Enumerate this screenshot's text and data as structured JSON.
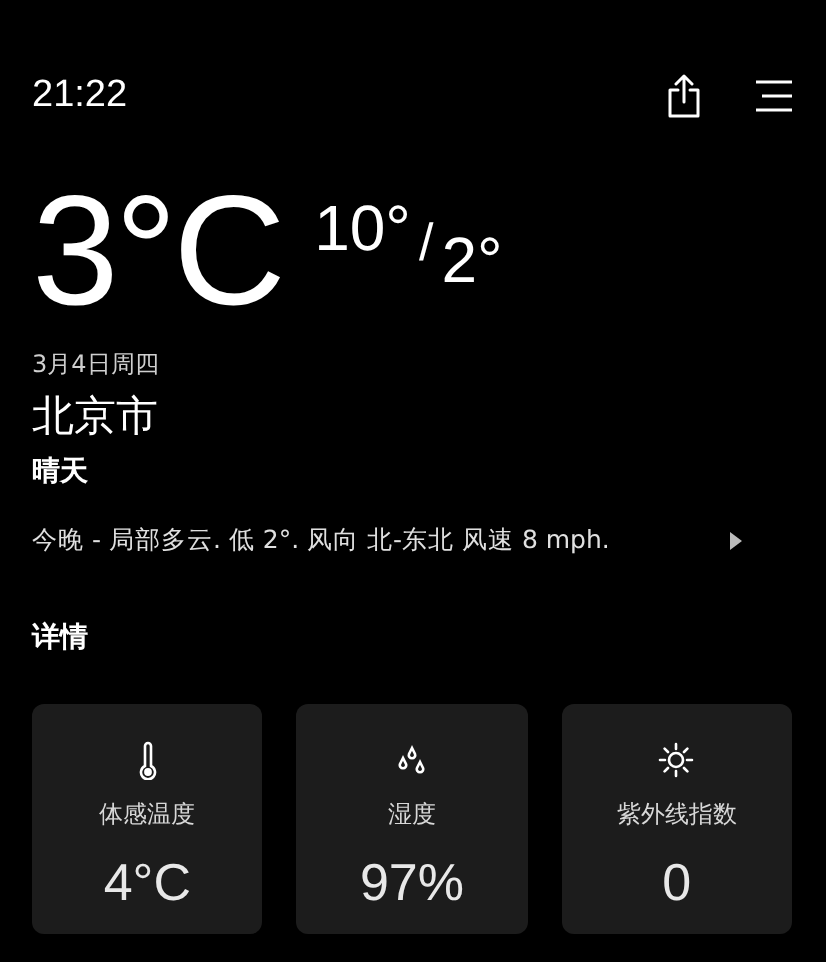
{
  "status_bar": {
    "time": "21:22"
  },
  "current": {
    "temperature": "3°C",
    "high": "10°",
    "separator": "/",
    "low": "2°"
  },
  "date": "3月4日周四",
  "city": "北京市",
  "condition": "晴天",
  "forecast": {
    "text": "今晚 - 局部多云. 低 2°. 风向 北-东北 风速 8 mph."
  },
  "details": {
    "title": "详情",
    "cards": [
      {
        "kind": "thermometer",
        "label": "体感温度",
        "value": "4°C"
      },
      {
        "kind": "humidity",
        "label": "湿度",
        "value": "97%"
      },
      {
        "kind": "sun",
        "label": "紫外线指数",
        "value": "0"
      }
    ]
  }
}
